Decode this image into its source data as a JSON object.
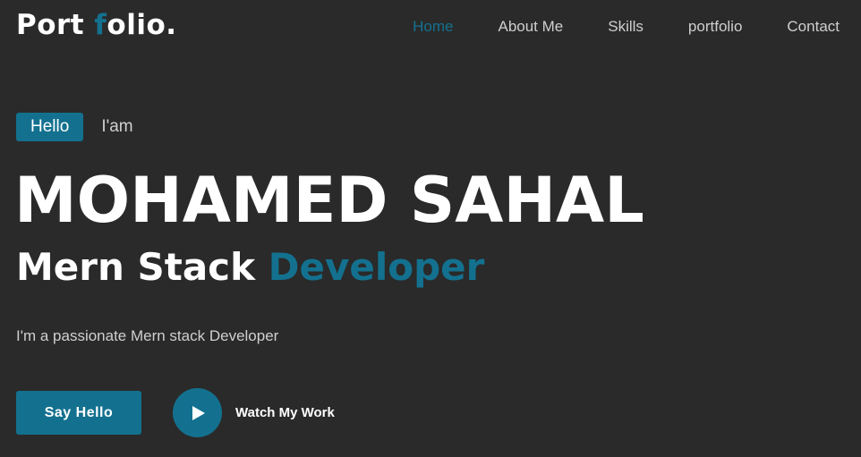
{
  "header": {
    "logo_part1": "Port ",
    "logo_accent": "f",
    "logo_part2": "olio."
  },
  "nav": {
    "items": [
      {
        "label": "Home",
        "active": true
      },
      {
        "label": "About Me",
        "active": false
      },
      {
        "label": "Skills",
        "active": false
      },
      {
        "label": "portfolio",
        "active": false
      },
      {
        "label": "Contact",
        "active": false
      }
    ]
  },
  "hero": {
    "hello_badge": "Hello",
    "iam": "I'am",
    "name": "MOHAMED SAHAL",
    "role_part1": "Mern Stack ",
    "role_accent": "Developer",
    "tagline": "I'm a passionate Mern stack Developer",
    "say_hello_label": "Say Hello",
    "watch_label": "Watch My Work"
  },
  "colors": {
    "background": "#2a2a2a",
    "accent": "#13718f",
    "text": "#ffffff",
    "muted_text": "#cfcfcf"
  },
  "icons": {
    "play": "play-icon"
  }
}
